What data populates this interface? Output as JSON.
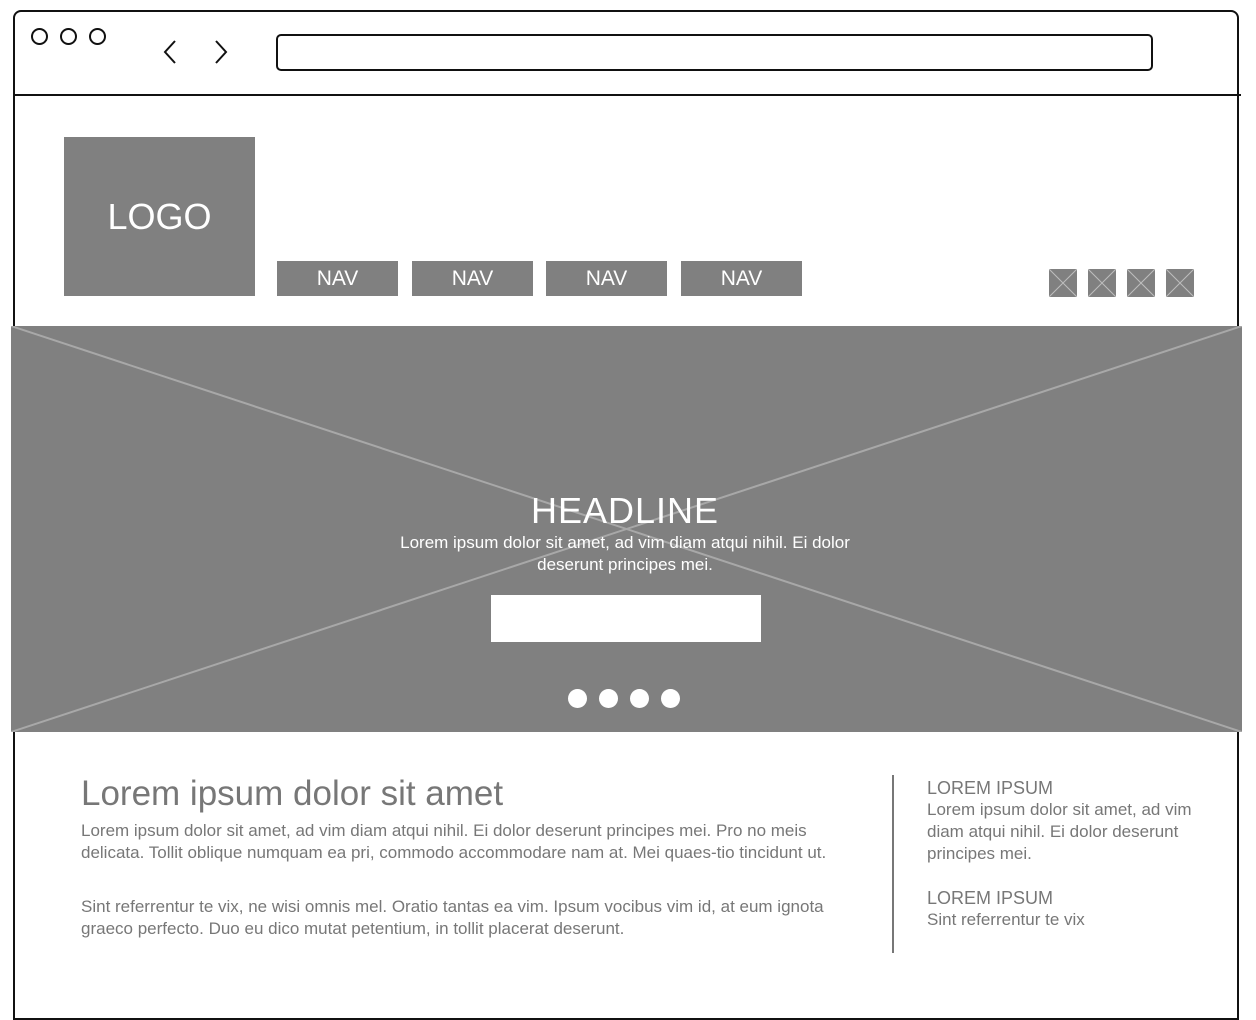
{
  "browser": {
    "back_icon": "chevron-left-icon",
    "forward_icon": "chevron-right-icon",
    "address_value": ""
  },
  "header": {
    "logo_text": "LOGO",
    "nav": [
      "NAV",
      "NAV",
      "NAV",
      "NAV"
    ],
    "social_icons": [
      "placeholder-icon",
      "placeholder-icon",
      "placeholder-icon",
      "placeholder-icon"
    ]
  },
  "hero": {
    "headline": "HEADLINE",
    "text": "Lorem ipsum dolor sit amet, ad vim diam atqui nihil. Ei dolor deserunt principes mei.",
    "cta_label": "",
    "slide_count": 4
  },
  "main": {
    "title": "Lorem ipsum dolor sit amet",
    "paragraphs": [
      "Lorem ipsum dolor sit amet, ad vim diam atqui nihil. Ei dolor deserunt principes mei. Pro no meis delicata. Tollit oblique numquam ea pri, commodo accommodare nam at. Mei quaes-tio tincidunt ut.",
      "Sint referrentur te vix, ne wisi omnis mel. Oratio tantas ea vim. Ipsum vocibus vim id, at eum ignota graeco perfecto. Duo eu dico mutat petentium, in tollit placerat deserunt."
    ]
  },
  "sidebar": {
    "blocks": [
      {
        "heading": "LOREM IPSUM",
        "text": "Lorem ipsum dolor sit amet, ad vim diam atqui nihil. Ei dolor deserunt principes mei."
      },
      {
        "heading": "LOREM IPSUM",
        "text": "Sint referrentur te vix"
      }
    ]
  },
  "colors": {
    "placeholder_gray": "#808080",
    "text_gray": "#777777",
    "frame": "#111111"
  }
}
